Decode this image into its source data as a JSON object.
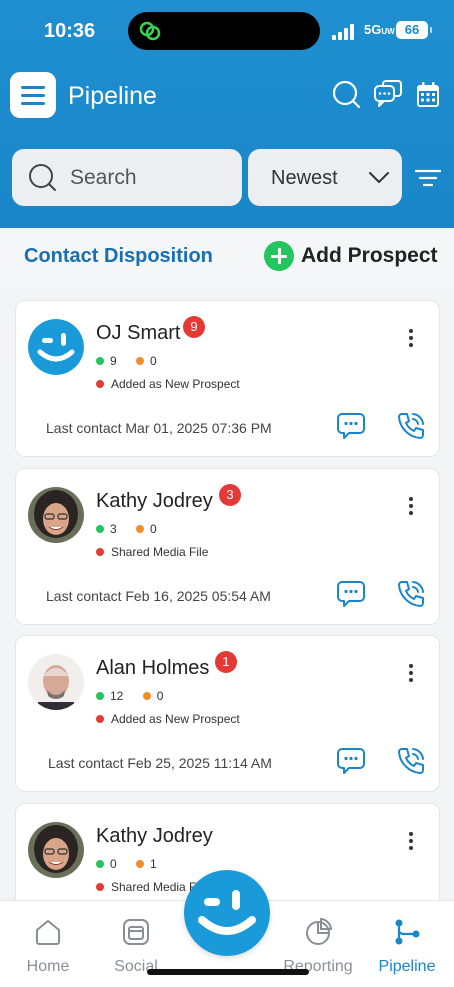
{
  "status_bar": {
    "time": "10:36",
    "network": "5G",
    "network_suffix": "UW",
    "battery": "66"
  },
  "header": {
    "title": "Pipeline"
  },
  "search": {
    "placeholder": "Search"
  },
  "sort": {
    "selected": "Newest"
  },
  "subheader": {
    "contact_disposition": "Contact Disposition",
    "add_prospect": "Add Prospect"
  },
  "contacts": [
    {
      "name": "OJ Smart",
      "badge": "9",
      "green_count": "9",
      "orange_count": "0",
      "activity": "Added as New Prospect",
      "last_contact": "Last contact Mar 01, 2025 07:36 PM",
      "avatar": "logo"
    },
    {
      "name": "Kathy Jodrey",
      "badge": "3",
      "green_count": "3",
      "orange_count": "0",
      "activity": "Shared Media File",
      "last_contact": "Last contact Feb 16, 2025 05:54 AM",
      "avatar": "photo-woman"
    },
    {
      "name": "Alan Holmes",
      "badge": "1",
      "green_count": "12",
      "orange_count": "0",
      "activity": "Added as New Prospect",
      "last_contact": "Last contact Feb 25, 2025 11:14 AM",
      "avatar": "photo-man"
    },
    {
      "name": "Kathy Jodrey",
      "badge": "",
      "green_count": "0",
      "orange_count": "1",
      "activity": "Shared Media File",
      "last_contact": "",
      "avatar": "photo-woman"
    }
  ],
  "tabs": [
    {
      "label": "Home",
      "icon": "home-icon"
    },
    {
      "label": "Social",
      "icon": "social-icon"
    },
    {
      "label": "Reporting",
      "icon": "reporting-icon"
    },
    {
      "label": "Pipeline",
      "icon": "pipeline-icon",
      "active": true
    }
  ],
  "colors": {
    "primary": "#1a86c9",
    "green": "#22c55e",
    "orange": "#f28c28",
    "red": "#e53935"
  }
}
